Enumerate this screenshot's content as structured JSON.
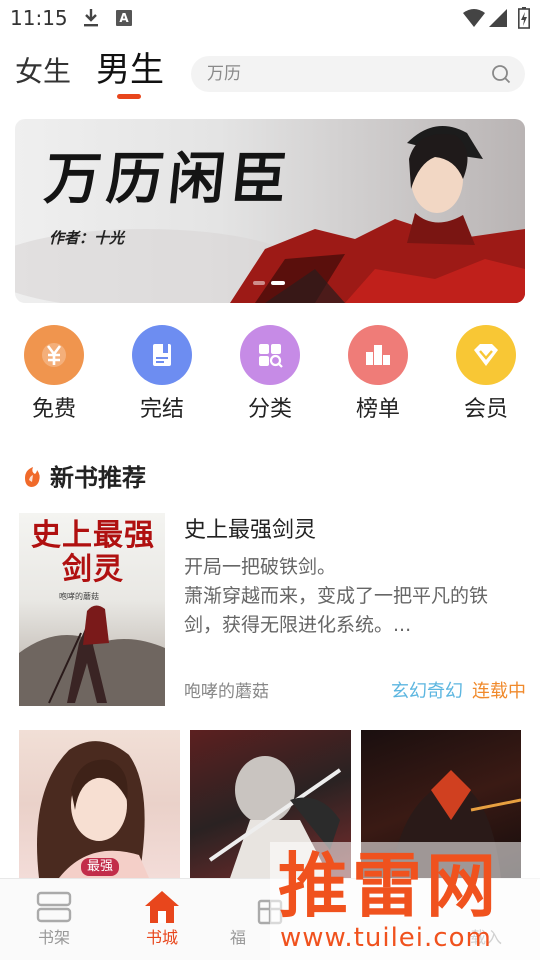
{
  "status_bar": {
    "time": "11:15",
    "notification_a": "A"
  },
  "header": {
    "tab_female": "女生",
    "tab_male": "男生",
    "search_placeholder": "万历",
    "accent_color": "#e8461c"
  },
  "banner": {
    "title": "万历闲臣",
    "author_line": "作者：十光",
    "page_count": 2,
    "active_page": 2
  },
  "categories": [
    {
      "label": "免费",
      "icon": "yen-icon",
      "color": "#f0954e"
    },
    {
      "label": "完结",
      "icon": "book-icon",
      "color": "#6d8df1"
    },
    {
      "label": "分类",
      "icon": "grid-search-icon",
      "color": "#c68be6"
    },
    {
      "label": "榜单",
      "icon": "ranking-icon",
      "color": "#ef7c78"
    },
    {
      "label": "会员",
      "icon": "diamond-icon",
      "color": "#f8c735"
    }
  ],
  "section": {
    "title": "新书推荐",
    "icon": "flame-icon"
  },
  "featured_book": {
    "cover_title": "史上最强剑灵",
    "cover_author": "咆哮的蘑菇",
    "title": "史上最强剑灵",
    "description_line1": "开局一把破铁剑。",
    "description_line2": "萧渐穿越而来，变成了一把平凡的铁",
    "description_line3": "剑，获得无限进化系统。...",
    "author": "咆哮的蘑菇",
    "genre": "玄幻奇幻",
    "status": "连载中"
  },
  "thumbnails": [
    {
      "badge": "最强"
    },
    {
      "badge": ""
    },
    {
      "badge": ""
    }
  ],
  "bottom_nav": [
    {
      "label": "书架",
      "icon": "bookshelf-icon",
      "active": false
    },
    {
      "label": "书城",
      "icon": "home-icon",
      "active": true
    },
    {
      "label": "福",
      "icon": "gift-icon",
      "active": false
    },
    {
      "label": "",
      "icon": "",
      "active": false
    },
    {
      "label": "载入",
      "icon": "",
      "active": false
    }
  ],
  "watermark": {
    "text": "推雷网",
    "url": "www.tuilei.com"
  }
}
